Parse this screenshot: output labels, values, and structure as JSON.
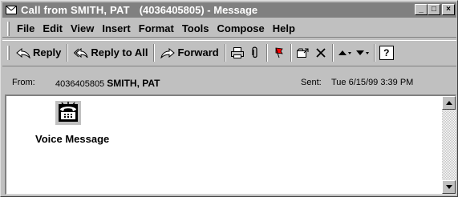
{
  "window": {
    "title_prefix": "Call from ",
    "title_name": "SMITH, PAT",
    "title_number": "(4036405805)",
    "title_suffix": " - Message",
    "minimize_glyph": "_",
    "maximize_glyph": "□",
    "close_glyph": "×"
  },
  "menu": [
    "File",
    "Edit",
    "View",
    "Insert",
    "Format",
    "Tools",
    "Compose",
    "Help"
  ],
  "toolbar": {
    "reply": "Reply",
    "reply_all": "Reply to All",
    "forward": "Forward",
    "help_glyph": "?"
  },
  "header": {
    "from_label": "From:",
    "from_number": "4036405805",
    "from_name": "SMITH, PAT",
    "sent_label": "Sent:",
    "sent_value": "Tue 6/15/99 3:39 PM"
  },
  "body": {
    "attachment_label": "Voice Message"
  },
  "icons": {
    "app": "envelope-icon",
    "attachment": "telephone-icon",
    "print": "printer-icon",
    "attach": "paperclip-icon",
    "flag": "flag-icon",
    "move": "move-to-folder-icon",
    "delete": "delete-icon",
    "previous": "previous-item-icon",
    "next": "next-item-icon",
    "help": "help-icon"
  }
}
